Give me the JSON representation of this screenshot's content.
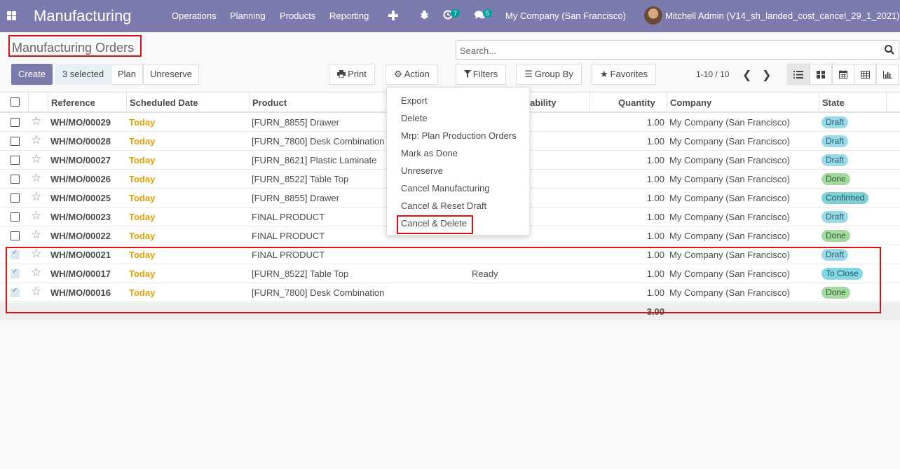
{
  "navbar": {
    "app_name": "Manufacturing",
    "menus": [
      "Operations",
      "Planning",
      "Products",
      "Reporting"
    ],
    "activity_count": "7",
    "messages_count": "5",
    "company": "My Company (San Francisco)",
    "user": "Mitchell Admin (V14_sh_landed_cost_cancel_29_1_2021)"
  },
  "breadcrumb": {
    "title": "Manufacturing Orders"
  },
  "search": {
    "placeholder": "Search..."
  },
  "buttons": {
    "create": "Create",
    "selected": "3 selected",
    "plan": "Plan",
    "unreserve": "Unreserve",
    "print": "Print",
    "action": "Action",
    "filters": "Filters",
    "group_by": "Group By",
    "favorites": "Favorites"
  },
  "pager": {
    "value": "1-10 / 10"
  },
  "table": {
    "headers": {
      "reference": "Reference",
      "scheduled_date": "Scheduled Date",
      "product": "Product",
      "availability": "ability",
      "quantity": "Quantity",
      "company": "Company",
      "state": "State"
    },
    "rows": [
      {
        "ref": "WH/MO/00029",
        "date": "Today",
        "product": "[FURN_8855] Drawer",
        "availability": "",
        "qty": "1.00",
        "company": "My Company (San Francisco)",
        "state": "Draft",
        "state_class": "st-draft",
        "checked": false
      },
      {
        "ref": "WH/MO/00028",
        "date": "Today",
        "product": "[FURN_7800] Desk Combination",
        "availability": "",
        "qty": "1.00",
        "company": "My Company (San Francisco)",
        "state": "Draft",
        "state_class": "st-draft",
        "checked": false
      },
      {
        "ref": "WH/MO/00027",
        "date": "Today",
        "product": "[FURN_8621] Plastic Laminate",
        "availability": "",
        "qty": "1.00",
        "company": "My Company (San Francisco)",
        "state": "Draft",
        "state_class": "st-draft",
        "checked": false
      },
      {
        "ref": "WH/MO/00026",
        "date": "Today",
        "product": "[FURN_8522] Table Top",
        "availability": "",
        "qty": "1.00",
        "company": "My Company (San Francisco)",
        "state": "Done",
        "state_class": "st-done",
        "checked": false
      },
      {
        "ref": "WH/MO/00025",
        "date": "Today",
        "product": "[FURN_8855] Drawer",
        "availability": "",
        "qty": "1.00",
        "company": "My Company (San Francisco)",
        "state": "Confirmed",
        "state_class": "st-confirmed",
        "checked": false
      },
      {
        "ref": "WH/MO/00023",
        "date": "Today",
        "product": "FINAL PRODUCT",
        "availability": "",
        "qty": "1.00",
        "company": "My Company (San Francisco)",
        "state": "Draft",
        "state_class": "st-draft",
        "checked": false
      },
      {
        "ref": "WH/MO/00022",
        "date": "Today",
        "product": "FINAL PRODUCT",
        "availability": "",
        "qty": "1.00",
        "company": "My Company (San Francisco)",
        "state": "Done",
        "state_class": "st-done",
        "checked": false
      },
      {
        "ref": "WH/MO/00021",
        "date": "Today",
        "product": "FINAL PRODUCT",
        "availability": "",
        "qty": "1.00",
        "company": "My Company (San Francisco)",
        "state": "Draft",
        "state_class": "st-draft",
        "checked": true
      },
      {
        "ref": "WH/MO/00017",
        "date": "Today",
        "product": "[FURN_8522] Table Top",
        "availability": "Ready",
        "qty": "1.00",
        "company": "My Company (San Francisco)",
        "state": "To Close",
        "state_class": "st-toclose",
        "checked": true
      },
      {
        "ref": "WH/MO/00016",
        "date": "Today",
        "product": "[FURN_7800] Desk Combination",
        "availability": "",
        "qty": "1.00",
        "company": "My Company (San Francisco)",
        "state": "Done",
        "state_class": "st-done",
        "checked": true
      }
    ],
    "total_qty": "3.00"
  },
  "action_menu": {
    "items": [
      "Export",
      "Delete",
      "Mrp: Plan Production Orders",
      "Mark as Done",
      "Unreserve",
      "Cancel Manufacturing",
      "Cancel & Reset Draft",
      "Cancel & Delete"
    ]
  },
  "colors": {
    "navbar": "#7c7bad",
    "highlight": "#dd1111",
    "today": "#e0a10a"
  }
}
